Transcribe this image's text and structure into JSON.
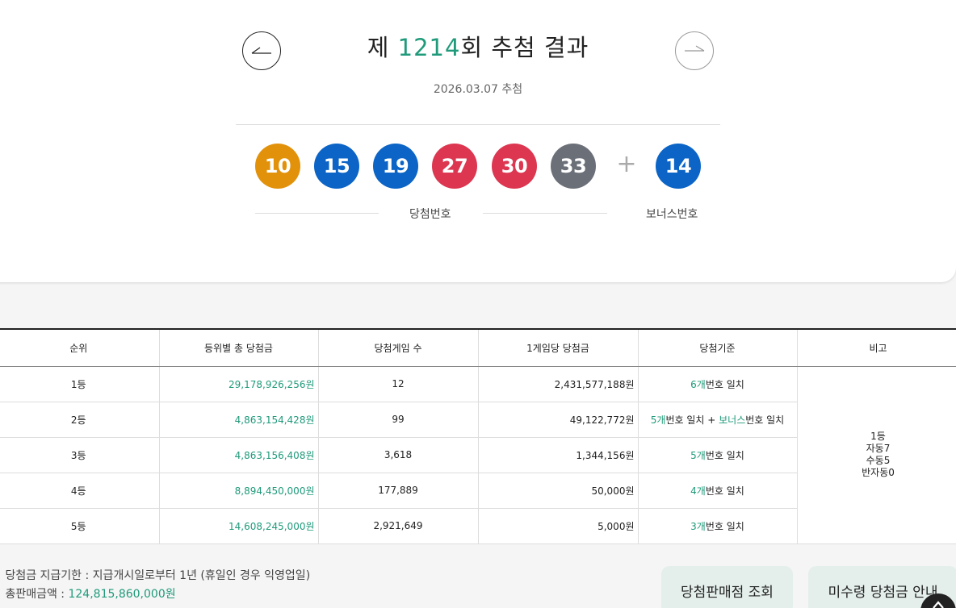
{
  "header": {
    "title_prefix": "제 ",
    "round": "1214",
    "title_suffix": "회 추첨 결과",
    "draw_date": "2026.03.07 추첨"
  },
  "numbers": {
    "main": [
      {
        "value": "10",
        "color": "#e2910a"
      },
      {
        "value": "15",
        "color": "#0b64c6"
      },
      {
        "value": "19",
        "color": "#0b64c6"
      },
      {
        "value": "27",
        "color": "#dc3650"
      },
      {
        "value": "30",
        "color": "#dc3650"
      },
      {
        "value": "33",
        "color": "#6b6f78"
      }
    ],
    "plus": "+",
    "bonus": {
      "value": "14",
      "color": "#0b64c6"
    },
    "main_label": "당첨번호",
    "bonus_label": "보너스번호"
  },
  "table": {
    "headers": [
      "순위",
      "등위별 총 당첨금",
      "당첨게임 수",
      "1게임당 당첨금",
      "당첨기준",
      "비고"
    ],
    "rows": [
      {
        "rank": "1등",
        "total": "29,178,926,256원",
        "winners": "12",
        "per_game": "2,431,577,188원",
        "criteria_count": "6개",
        "criteria_text": "번호 일치"
      },
      {
        "rank": "2등",
        "total": "4,863,154,428원",
        "winners": "99",
        "per_game": "49,122,772원",
        "criteria_count": "5개",
        "criteria_text": "번호 일치 + ",
        "criteria_bonus": "보너스",
        "criteria_tail": "번호 일치"
      },
      {
        "rank": "3등",
        "total": "4,863,156,408원",
        "winners": "3,618",
        "per_game": "1,344,156원",
        "criteria_count": "5개",
        "criteria_text": "번호 일치"
      },
      {
        "rank": "4등",
        "total": "8,894,450,000원",
        "winners": "177,889",
        "per_game": "50,000원",
        "criteria_count": "4개",
        "criteria_text": "번호 일치"
      },
      {
        "rank": "5등",
        "total": "14,608,245,000원",
        "winners": "2,921,649",
        "per_game": "5,000원",
        "criteria_count": "3개",
        "criteria_text": "번호 일치"
      }
    ],
    "note_lines": [
      "1등",
      "자동7",
      "수동5",
      "반자동0"
    ]
  },
  "info": {
    "deadline_label": "당첨금 지급기한 : 지급개시일로부터 1년 (휴일인 경우 익영업일)",
    "total_sales_label": "총판매금액 : ",
    "total_sales_value": "124,815,860,000원"
  },
  "buttons": {
    "store": "당첨판매점 조회",
    "unclaimed": "미수령 당첨금 안내"
  },
  "icons": {
    "prev": "arrow-left-icon",
    "next": "arrow-right-icon",
    "scroll_top": "arrow-up-icon"
  }
}
